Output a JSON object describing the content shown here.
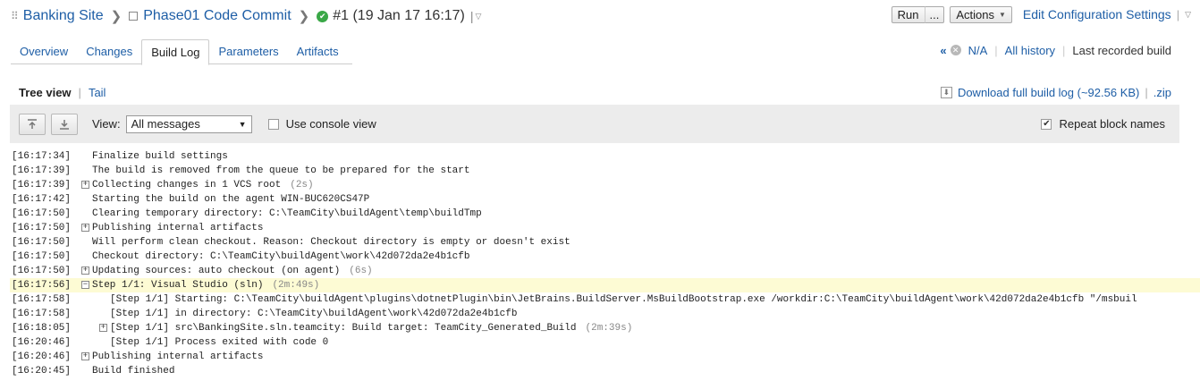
{
  "breadcrumb": {
    "project": "Banking Site",
    "config": "Phase01 Code Commit",
    "build": "#1 (19 Jan 17 16:17)",
    "bar": "|"
  },
  "top_actions": {
    "run": "Run",
    "run_more": "...",
    "actions": "Actions",
    "edit_config": "Edit Configuration Settings",
    "sep": "|"
  },
  "tabs": [
    {
      "label": "Overview",
      "active": false
    },
    {
      "label": "Changes",
      "active": false
    },
    {
      "label": "Build Log",
      "active": true
    },
    {
      "label": "Parameters",
      "active": false
    },
    {
      "label": "Artifacts",
      "active": false
    }
  ],
  "history": {
    "prev": "«",
    "na": "N/A",
    "all": "All history",
    "sep": "|",
    "last": "Last recorded build"
  },
  "viewmode": {
    "tree": "Tree view",
    "sep": "|",
    "tail": "Tail"
  },
  "download": {
    "full": "Download full build log (~92.56 KB)",
    "sep": "|",
    "zip": ".zip"
  },
  "toolbar": {
    "view_label": "View:",
    "view_value": "All messages",
    "console_label": "Use console view",
    "console_checked": false,
    "repeat_label": "Repeat block names",
    "repeat_checked": true
  },
  "log": [
    {
      "ts": "[16:17:34]",
      "msg": "Finalize build settings",
      "indent": 0,
      "toggle": "",
      "dur": "",
      "hl": false
    },
    {
      "ts": "[16:17:39]",
      "msg": "The build is removed from the queue to be prepared for the start",
      "indent": 0,
      "toggle": "",
      "dur": "",
      "hl": false
    },
    {
      "ts": "[16:17:39]",
      "msg": "Collecting changes in 1 VCS root",
      "indent": 0,
      "toggle": "+",
      "dur": "(2s)",
      "hl": false
    },
    {
      "ts": "[16:17:42]",
      "msg": "Starting the build on the agent WIN-BUC620CS47P",
      "indent": 0,
      "toggle": "",
      "dur": "",
      "hl": false
    },
    {
      "ts": "[16:17:50]",
      "msg": "Clearing temporary directory: C:\\TeamCity\\buildAgent\\temp\\buildTmp",
      "indent": 0,
      "toggle": "",
      "dur": "",
      "hl": false
    },
    {
      "ts": "[16:17:50]",
      "msg": "Publishing internal artifacts",
      "indent": 0,
      "toggle": "+",
      "dur": "",
      "hl": false
    },
    {
      "ts": "[16:17:50]",
      "msg": "Will perform clean checkout. Reason: Checkout directory is empty or doesn't exist",
      "indent": 0,
      "toggle": "",
      "dur": "",
      "hl": false
    },
    {
      "ts": "[16:17:50]",
      "msg": "Checkout directory: C:\\TeamCity\\buildAgent\\work\\42d072da2e4b1cfb",
      "indent": 0,
      "toggle": "",
      "dur": "",
      "hl": false
    },
    {
      "ts": "[16:17:50]",
      "msg": "Updating sources: auto checkout (on agent)",
      "indent": 0,
      "toggle": "+",
      "dur": "(6s)",
      "hl": false
    },
    {
      "ts": "[16:17:56]",
      "msg": "Step 1/1: Visual Studio (sln)",
      "indent": 0,
      "toggle": "−",
      "dur": "(2m:49s)",
      "hl": true
    },
    {
      "ts": "[16:17:58]",
      "msg": "[Step 1/1] Starting: C:\\TeamCity\\buildAgent\\plugins\\dotnetPlugin\\bin\\JetBrains.BuildServer.MsBuildBootstrap.exe /workdir:C:\\TeamCity\\buildAgent\\work\\42d072da2e4b1cfb \"/msbuil",
      "indent": 1,
      "toggle": "",
      "dur": "",
      "hl": false
    },
    {
      "ts": "[16:17:58]",
      "msg": "[Step 1/1] in directory: C:\\TeamCity\\buildAgent\\work\\42d072da2e4b1cfb",
      "indent": 1,
      "toggle": "",
      "dur": "",
      "hl": false
    },
    {
      "ts": "[16:18:05]",
      "msg": "[Step 1/1] src\\BankingSite.sln.teamcity: Build target: TeamCity_Generated_Build",
      "indent": 1,
      "toggle": "+",
      "dur": "(2m:39s)",
      "hl": false
    },
    {
      "ts": "[16:20:46]",
      "msg": "[Step 1/1] Process exited with code 0",
      "indent": 1,
      "toggle": "",
      "dur": "",
      "hl": false
    },
    {
      "ts": "[16:20:46]",
      "msg": "Publishing internal artifacts",
      "indent": 0,
      "toggle": "+",
      "dur": "",
      "hl": false
    },
    {
      "ts": "[16:20:45]",
      "msg": "Build finished",
      "indent": 0,
      "toggle": "",
      "dur": "",
      "hl": false
    }
  ]
}
